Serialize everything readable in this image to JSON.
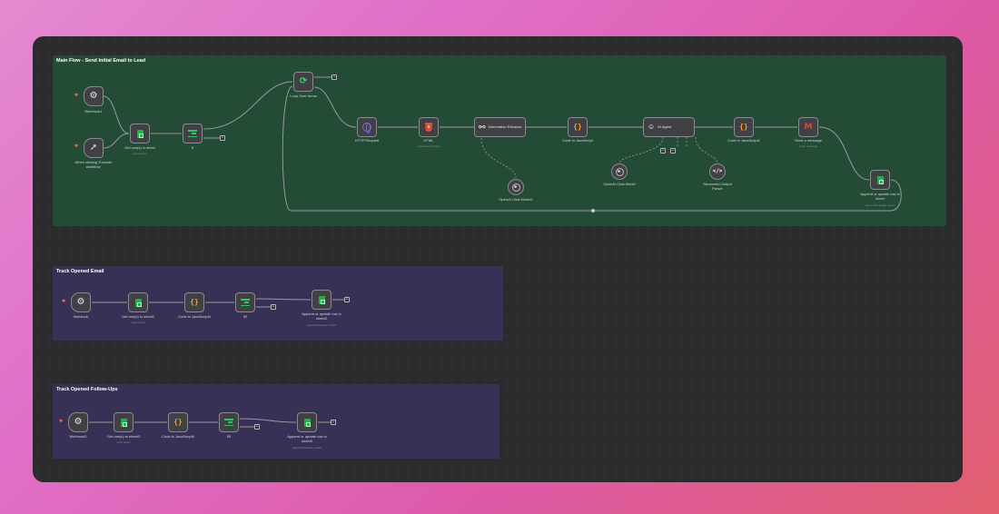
{
  "groups": {
    "main": {
      "title": "Main Flow - Send Initial Email to Lead"
    },
    "track_email": {
      "title": "Track Opened Email"
    },
    "track_followups": {
      "title": "Track Opened Follow-Ups"
    }
  },
  "main_nodes": {
    "webhook1": {
      "label": "Webhook1"
    },
    "manual_trigger": {
      "label": "When clicking 'Execute workflow'"
    },
    "get_rows_sheet": {
      "label": "Get row(s) in sheet",
      "sub": "read: sheet"
    },
    "if_node": {
      "label": "If"
    },
    "loop": {
      "label": "Loop Over Items"
    },
    "http": {
      "label": "HTTP Request"
    },
    "html": {
      "label": "HTML",
      "sub": "extractHtmlContent"
    },
    "info_extractor": {
      "label": "Information Extractor"
    },
    "openai_chat1": {
      "label": "OpenAI Chat Model1"
    },
    "code_js": {
      "label": "Code in JavaScript"
    },
    "ai_agent": {
      "label": "AI Agent"
    },
    "openai_chat": {
      "label": "OpenAI Chat Model"
    },
    "output_parser": {
      "label": "Structured Output Parser"
    },
    "code_js2": {
      "label": "Code in JavaScript2"
    },
    "send_message": {
      "label": "Send a message",
      "sub": "send: message"
    },
    "append_sheet": {
      "label": "Append or update row in sheet",
      "sub": "appendOrUpdate: sheet"
    }
  },
  "track_email_nodes": {
    "webhook": {
      "label": "Webhook"
    },
    "get_rows2": {
      "label": "Get row(s) in sheet2",
      "sub": "read: sheet"
    },
    "code_js4": {
      "label": "Code in JavaScript4"
    },
    "if2": {
      "label": "If2"
    },
    "append_sheet2": {
      "label": "Append or update row in sheet2",
      "sub": "appendOrUpdate: sheet"
    }
  },
  "track_followup_nodes": {
    "webhook3": {
      "label": "Webhook3"
    },
    "get_rows3": {
      "label": "Get row(s) in sheet3",
      "sub": "read: sheet"
    },
    "code_js5": {
      "label": "Code in JavaScript5"
    },
    "if3": {
      "label": "If3"
    },
    "append_sheet3": {
      "label": "Append or update row in sheet3",
      "sub": "appendOrUpdate: sheet"
    }
  },
  "icons": {
    "webhook": "webhook-icon",
    "sheets": "google-sheets-icon",
    "code": "code-braces-icon",
    "if": "if-branch-icon",
    "loop": "loop-icon",
    "http": "globe-icon",
    "html": "html5-icon",
    "extractor": "extractor-icon",
    "agent": "robot-icon",
    "gmail": "gmail-icon",
    "openai": "openai-icon",
    "parser": "code-tag-icon",
    "manual": "cursor-click-icon"
  },
  "colors": {
    "main_group": "#234b36",
    "track_group": "#383055",
    "canvas": "#2b2b2d",
    "trigger_marker": "#ff6d5a"
  }
}
